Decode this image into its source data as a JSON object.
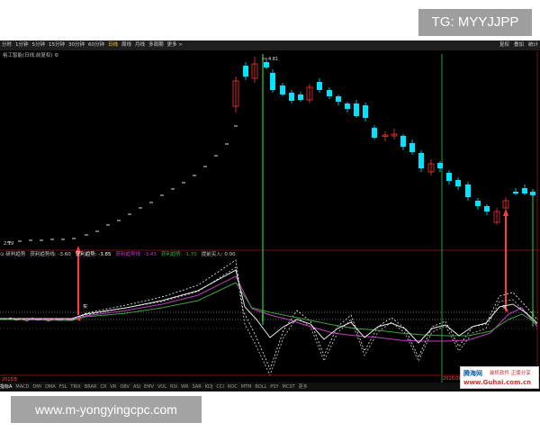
{
  "tg_badge": "TG: MYYJJPP",
  "url_badge": "www.m-yongyingcpc.com",
  "toolbar": {
    "periods": [
      {
        "label": "分时",
        "active": false
      },
      {
        "label": "1分钟",
        "active": false
      },
      {
        "label": "5分钟",
        "active": false
      },
      {
        "label": "15分钟",
        "active": false
      },
      {
        "label": "30分钟",
        "active": false
      },
      {
        "label": "60分钟",
        "active": false
      },
      {
        "label": "日线",
        "active": true
      },
      {
        "label": "周线",
        "active": false
      },
      {
        "label": "月线",
        "active": false
      },
      {
        "label": "多周期",
        "active": false
      },
      {
        "label": "更多 >",
        "active": false
      }
    ],
    "right_buttons": [
      "复权",
      "叠加",
      "统计"
    ]
  },
  "chart_title": "裕工智能(日线,前复权) ⚙",
  "price_labels": {
    "high": "4.81",
    "low": "2.19"
  },
  "buy_labels": [
    "买",
    "买"
  ],
  "indicator_bar": [
    {
      "text": "⊙ 研判趋势",
      "color": "#d0d0d0"
    },
    {
      "text": "获利趋势线: -3.60",
      "color": "#d0d0d0"
    },
    {
      "text": "获利趋势: -3.85",
      "color": "#ffffff"
    },
    {
      "text": "获利趋势线: -3.43",
      "color": "#c040c0"
    },
    {
      "text": "获利趋势: -1.70",
      "color": "#40b040"
    },
    {
      "text": "提前买入: 0.00",
      "color": "#d0d0d0"
    }
  ],
  "dates": {
    "left": "2015年",
    "right": "2015/08"
  },
  "tabs": [
    "指标A",
    "MACD",
    "DMI",
    "DMA",
    "FSL",
    "TRIX",
    "BRAR",
    "CR",
    "VR",
    "OBV",
    "ASI",
    "EMV",
    "VOL",
    "RSI",
    "WR",
    "SAR",
    "KDJ",
    "CCI",
    "ROC",
    "MTM",
    "BOLL",
    "PSY",
    "MCST",
    "更多"
  ],
  "logo": {
    "name": "腾海网",
    "slogan": "装机软件 正版分享",
    "url": "www.Guhai.com.cn"
  },
  "colors": {
    "up": "#ff3030",
    "down": "#00e5ff",
    "ma": "#ffffff",
    "signal_red": "#ff4040",
    "signal_green": "#33dd33"
  }
}
